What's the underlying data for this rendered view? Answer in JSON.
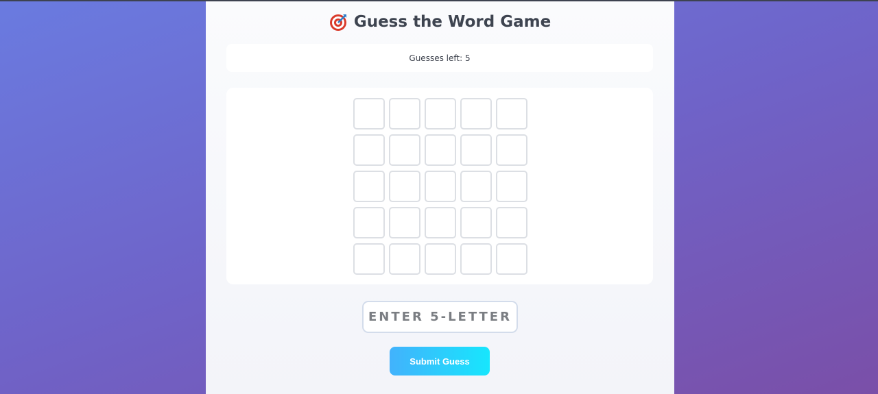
{
  "header": {
    "title": "Guess the Word Game",
    "icon": "target-icon"
  },
  "status": {
    "text": "Guesses left: 5"
  },
  "board": {
    "rows": 5,
    "cols": 5,
    "tiles": [
      [
        "",
        "",
        "",
        "",
        ""
      ],
      [
        "",
        "",
        "",
        "",
        ""
      ],
      [
        "",
        "",
        "",
        "",
        ""
      ],
      [
        "",
        "",
        "",
        "",
        ""
      ],
      [
        "",
        "",
        "",
        "",
        ""
      ]
    ]
  },
  "input": {
    "placeholder": "ENTER 5-LETTER",
    "value": ""
  },
  "submit": {
    "label": "Submit Guess"
  },
  "colors": {
    "accent_start": "#42b2fc",
    "accent_end": "#17e6fd",
    "title": "#3e4450",
    "tile_border": "#dcdfe4"
  }
}
